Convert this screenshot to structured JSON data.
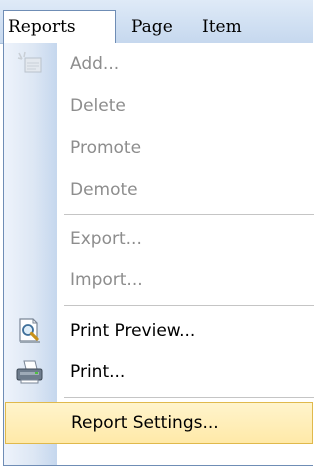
{
  "menubar": {
    "items": [
      {
        "label": "Reports"
      },
      {
        "label": "Page"
      },
      {
        "label": "Item"
      }
    ]
  },
  "dropdown": {
    "items": [
      {
        "label": "Add...",
        "enabled": false,
        "icon": "add-report-icon"
      },
      {
        "label": "Delete",
        "enabled": false
      },
      {
        "label": "Promote",
        "enabled": false
      },
      {
        "label": "Demote",
        "enabled": false
      },
      {
        "label": "Export...",
        "enabled": false
      },
      {
        "label": "Import...",
        "enabled": false
      },
      {
        "label": "Print Preview...",
        "enabled": true,
        "icon": "print-preview-icon"
      },
      {
        "label": "Print...",
        "enabled": true,
        "icon": "printer-icon"
      },
      {
        "label": "Report Settings...",
        "enabled": true,
        "highlighted": true
      }
    ]
  },
  "colors": {
    "menubar_bg": "#d2e1f3",
    "gutter": "#dde7f4",
    "border": "#6f8db5",
    "highlight": "#ffe9a8",
    "disabled_text": "#8d8d8d"
  }
}
